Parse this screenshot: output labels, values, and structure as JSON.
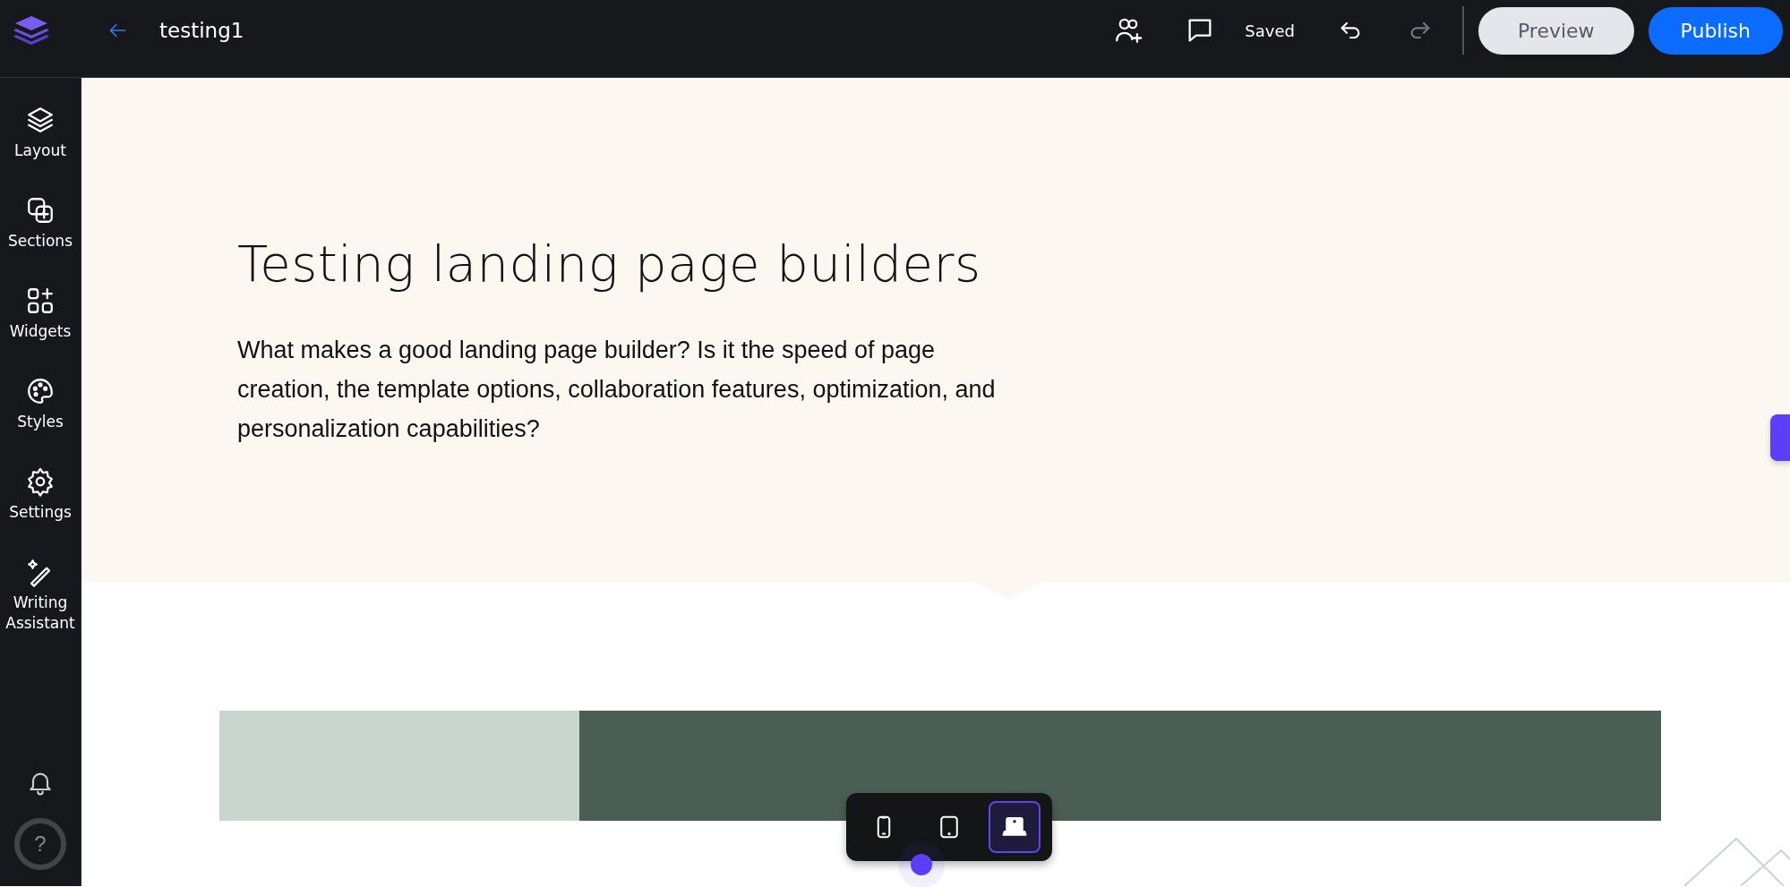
{
  "header": {
    "title": "testing1",
    "status": "Saved",
    "undo_enabled": true,
    "redo_enabled": false,
    "buttons": [
      {
        "label": "Preview",
        "kind": "secondary"
      },
      {
        "label": "Publish",
        "kind": "primary"
      }
    ]
  },
  "sidebar": {
    "items": [
      {
        "label": "Layout",
        "kind": "layers"
      },
      {
        "label": "Sections",
        "kind": "sections"
      },
      {
        "label": "Widgets",
        "kind": "widgets"
      },
      {
        "label": "Styles",
        "kind": "palette"
      },
      {
        "label": "Settings",
        "kind": "gear"
      },
      {
        "label": "Writing Assistant",
        "kind": "wand"
      }
    ]
  },
  "hero": {
    "heading": "Testing landing page builders",
    "body": "What makes a good landing page builder? Is it the speed of page creation, the template options, collaboration features, optimization, and personalization capabilities?"
  },
  "help": {
    "label": "?"
  },
  "devices": [
    {
      "kind": "phone",
      "selected": false
    },
    {
      "kind": "tablet",
      "selected": false
    },
    {
      "kind": "laptop",
      "selected": true
    }
  ]
}
